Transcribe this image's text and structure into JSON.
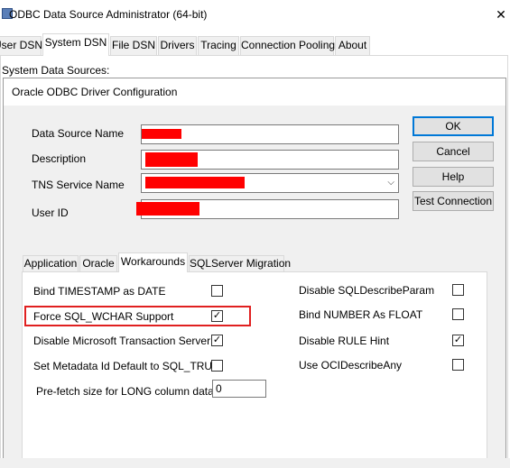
{
  "outer_window": {
    "title": "ODBC Data Source Administrator (64-bit)",
    "close_glyph": "✕",
    "tabs": [
      {
        "label": "User DSN"
      },
      {
        "label": "System DSN"
      },
      {
        "label": "File DSN"
      },
      {
        "label": "Drivers"
      },
      {
        "label": "Tracing"
      },
      {
        "label": "Connection Pooling"
      },
      {
        "label": "About"
      }
    ],
    "active_tab": "System DSN",
    "system_sources_label": "System Data Sources:"
  },
  "dialog": {
    "title": "Oracle ODBC Driver Configuration",
    "fields": {
      "data_source_name_label": "Data Source Name",
      "description_label": "Description",
      "tns_service_name_label": "TNS Service Name",
      "user_id_label": "User ID"
    },
    "buttons": {
      "ok": "OK",
      "cancel": "Cancel",
      "help": "Help",
      "test_connection": "Test Connection"
    },
    "tabs": [
      {
        "label": "Application"
      },
      {
        "label": "Oracle"
      },
      {
        "label": "Workarounds"
      },
      {
        "label": "SQLServer Migration"
      }
    ],
    "active_tab": "Workarounds",
    "workarounds": {
      "bind_timestamp": {
        "label": "Bind TIMESTAMP as DATE",
        "checked": false
      },
      "force_sql_wchar": {
        "label": "Force SQL_WCHAR Support",
        "checked": true
      },
      "disable_mts": {
        "label": "Disable Microsoft Transaction Server",
        "checked": true
      },
      "set_metadata_id": {
        "label": "Set Metadata Id Default to SQL_TRUE",
        "checked": false
      },
      "prefetch_label": "Pre-fetch size for LONG column data",
      "prefetch_value": "0",
      "disable_sqldescribeparam": {
        "label": "Disable SQLDescribeParam",
        "checked": false
      },
      "bind_number_float": {
        "label": "Bind NUMBER As FLOAT",
        "checked": false
      },
      "disable_rule_hint": {
        "label": "Disable RULE Hint",
        "checked": true
      },
      "use_ocidescribeany": {
        "label": "Use OCIDescribeAny",
        "checked": false
      }
    },
    "check_glyph": "✓",
    "highlight_color": "#e02020",
    "redaction_color": "#ff0000"
  }
}
